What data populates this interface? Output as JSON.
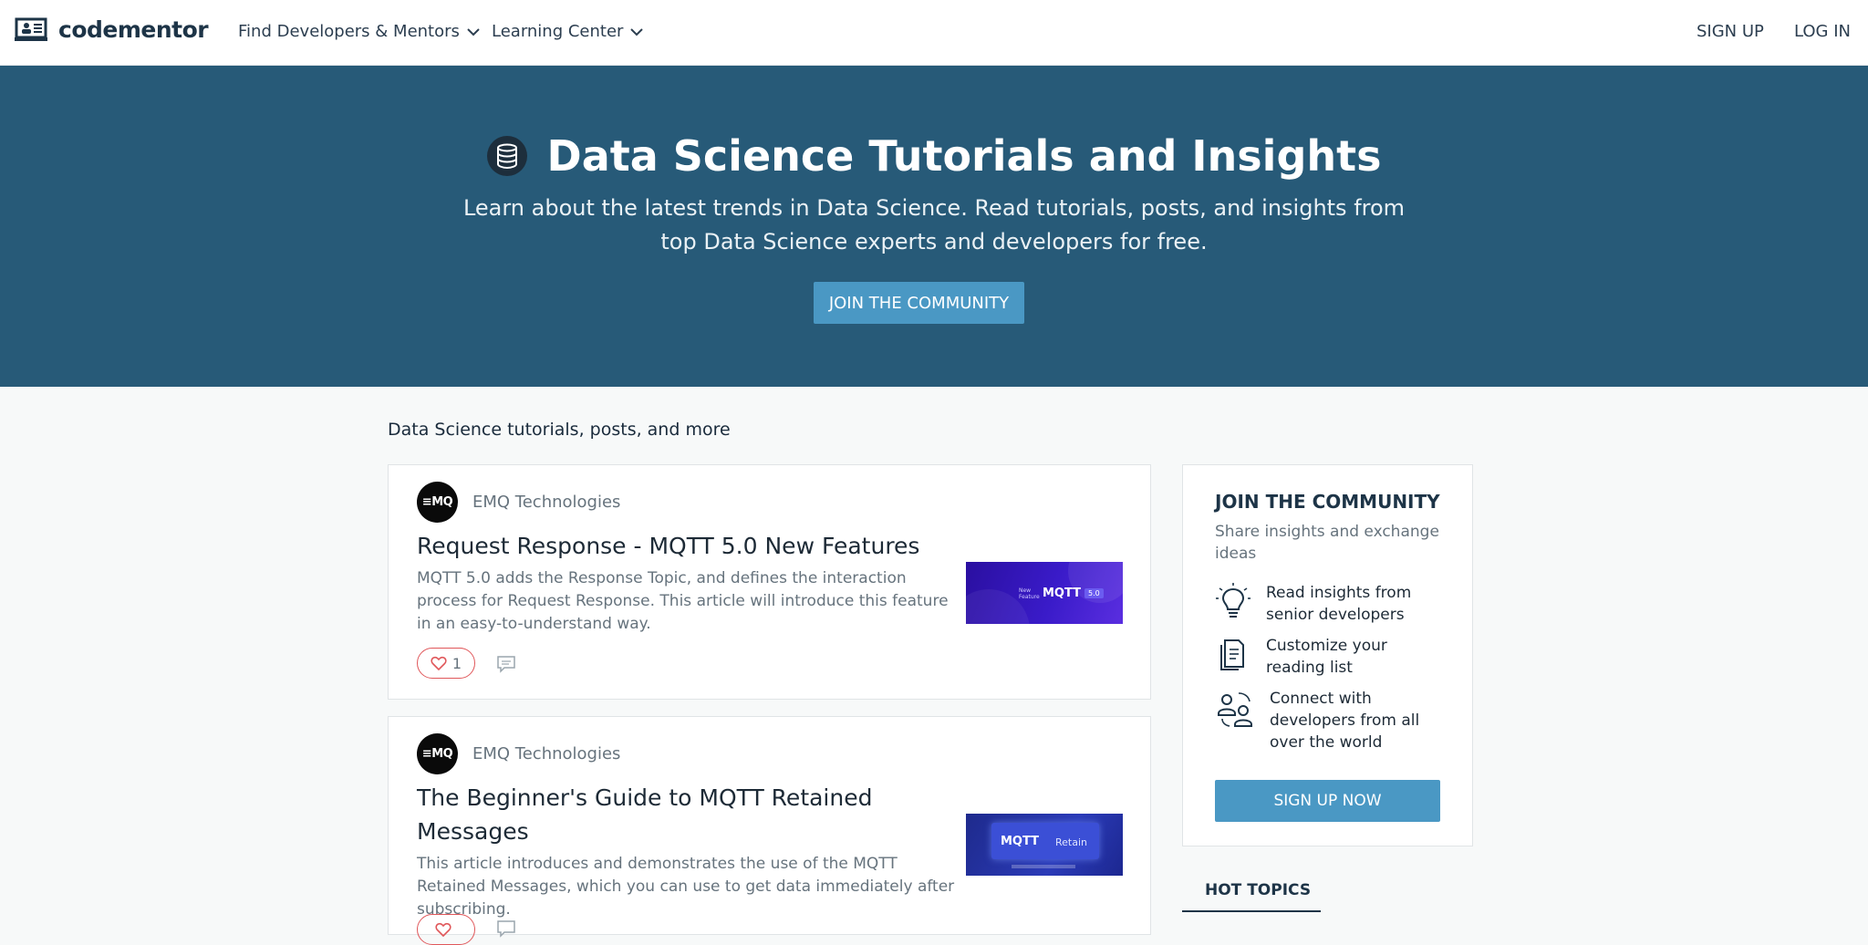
{
  "nav": {
    "logo_text": "codementor",
    "find_menu": "Find Developers & Mentors",
    "learning_menu": "Learning Center",
    "signup": "SIGN UP",
    "login": "LOG IN"
  },
  "hero": {
    "title": "Data Science Tutorials and Insights",
    "subtitle": "Learn about the latest trends in Data Science. Read tutorials, posts, and insights from top Data Science experts and developers for free.",
    "cta": "JOIN THE COMMUNITY"
  },
  "main": {
    "section_heading": "Data Science tutorials, posts, and more",
    "posts": [
      {
        "author": "EMQ Technologies",
        "avatar_text": "≡MQ",
        "title": "Request Response - MQTT 5.0 New Features",
        "description": "MQTT 5.0 adds the Response Topic, and defines the interaction process for Request Response. This article will introduce this feature in an easy-to-understand way.",
        "likes": "1",
        "thumb_small": "New Feature",
        "thumb_brand": "MQTT",
        "thumb_badge": "5.0"
      },
      {
        "author": "EMQ Technologies",
        "avatar_text": "≡MQ",
        "title": "The Beginner's Guide to MQTT Retained Messages",
        "description": "This article introduces and demonstrates the use of the MQTT Retained Messages, which you can use to get data immediately after subscribing.",
        "likes": "",
        "thumb_brand": "MQTT",
        "thumb_badge": "Retain"
      }
    ]
  },
  "sidebar": {
    "title": "JOIN THE COMMUNITY",
    "subtitle": "Share insights and exchange ideas",
    "benefits": [
      {
        "text": "Read insights from senior developers",
        "icon": "lightbulb-icon"
      },
      {
        "text": "Customize your reading list",
        "icon": "reading-list-icon"
      },
      {
        "text": "Connect with developers from all over the world",
        "icon": "connect-icon"
      }
    ],
    "cta": "SIGN UP NOW",
    "hot_topics": "HOT TOPICS"
  },
  "colors": {
    "hero_bg": "#275a78",
    "button": "#4a98c4",
    "like_border": "#e0575a"
  }
}
